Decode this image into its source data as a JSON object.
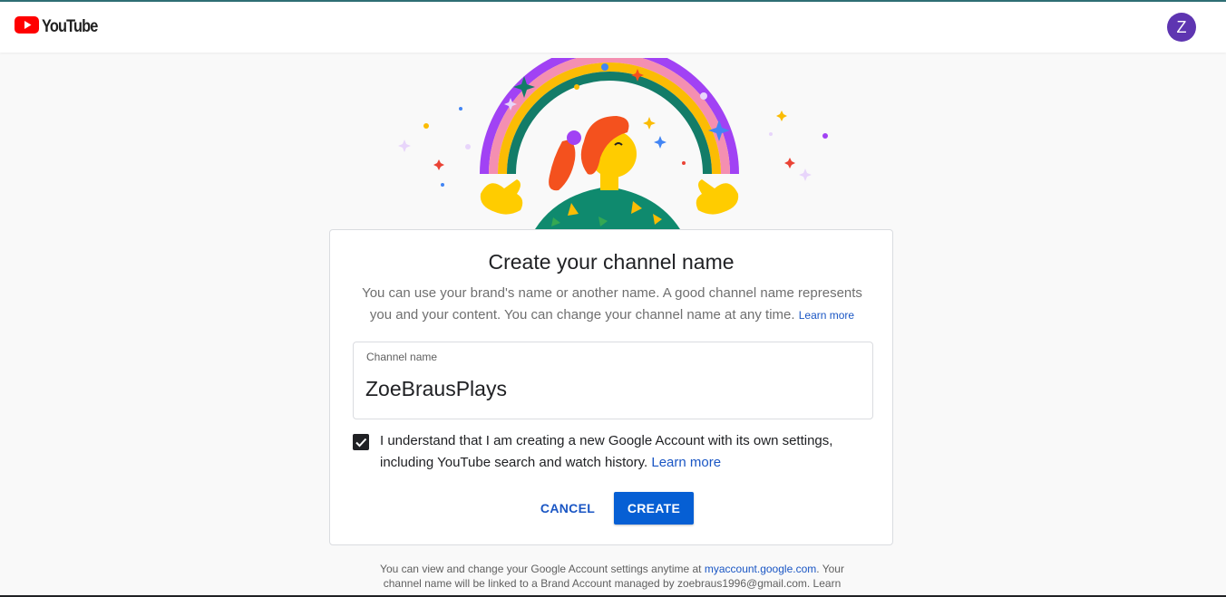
{
  "header": {
    "logo_text": "YouTube",
    "avatar_letter": "Z",
    "avatar_color": "#5e35b1"
  },
  "card": {
    "title": "Create your channel name",
    "description": "You can use your brand's name or another name. A good channel name represents you and your content. You can change your channel name at any time.",
    "description_link": "Learn more",
    "field_label": "Channel name",
    "field_value": "ZoeBrausPlays",
    "checkbox_checked": true,
    "checkbox_text": "I understand that I am creating a new Google Account with its own settings, including YouTube search and watch history.",
    "checkbox_link": "Learn more",
    "cancel_label": "CANCEL",
    "create_label": "CREATE"
  },
  "footer": {
    "text_before": "You can view and change your Google Account settings anytime at",
    "account_link": "myaccount.google.com",
    "text_after": ". Your channel name will be linked to a Brand Account managed by zoebraus1996@gmail.com. Learn"
  },
  "colors": {
    "accent": "#065fd4",
    "link": "#1a56c4",
    "youtube_red": "#ff0000"
  }
}
